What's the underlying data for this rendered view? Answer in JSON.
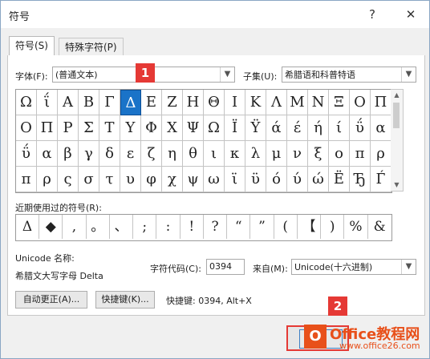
{
  "window": {
    "title": "符号",
    "help_label": "?",
    "close_label": "✕"
  },
  "tabs": [
    {
      "label": "符号(S)",
      "active": true
    },
    {
      "label": "特殊字符(P)",
      "active": false
    }
  ],
  "font": {
    "label": "字体(F):",
    "value": "(普通文本)"
  },
  "subset": {
    "label": "子集(U):",
    "value": "希腊语和科普特语"
  },
  "grid": {
    "rows": [
      [
        "Ω",
        "ΐ",
        "Α",
        "Β",
        "Γ",
        "Δ",
        "Ε",
        "Ζ",
        "Η",
        "Θ",
        "Ι",
        "Κ",
        "Λ",
        "Μ",
        "Ν",
        "Ξ",
        "Ο",
        "Π"
      ],
      [
        "Ο",
        "Π",
        "Ρ",
        "Σ",
        "Τ",
        "Υ",
        "Φ",
        "Χ",
        "Ψ",
        "Ω",
        "Ϊ",
        "Ϋ",
        "ά",
        "έ",
        "ή",
        "ί",
        "ΰ",
        "α"
      ],
      [
        "ΰ",
        "α",
        "β",
        "γ",
        "δ",
        "ε",
        "ζ",
        "η",
        "θ",
        "ι",
        "κ",
        "λ",
        "μ",
        "ν",
        "ξ",
        "ο",
        "π",
        "ρ"
      ],
      [
        "π",
        "ρ",
        "ς",
        "σ",
        "τ",
        "υ",
        "φ",
        "χ",
        "ψ",
        "ω",
        "ϊ",
        "ϋ",
        "ό",
        "ύ",
        "ώ",
        "Ë",
        "Ђ",
        "Ѓ"
      ]
    ],
    "selected": {
      "row": 0,
      "col": 5
    }
  },
  "recent": {
    "label": "近期使用过的符号(R):",
    "symbols": [
      "Δ",
      "◆",
      ",",
      "。",
      "、",
      ";",
      ":",
      "!",
      "?",
      "“",
      "”",
      "(",
      "【",
      ")",
      "%",
      "&"
    ]
  },
  "unicode": {
    "name_label": "Unicode 名称:",
    "name_value": "希腊文大写字母 Delta"
  },
  "code": {
    "label": "字符代码(C):",
    "value": "0394"
  },
  "from": {
    "label": "来自(M):",
    "value": "Unicode(十六进制)"
  },
  "buttons": {
    "autocorrect": "自动更正(A)...",
    "shortcut": "快捷键(K)...",
    "shortcut_text": "快捷键: 0394, Alt+X"
  },
  "markers": [
    "1",
    "2"
  ],
  "watermark": {
    "logo": "O",
    "text": "Office教程网",
    "sub": "www.office26.com"
  }
}
